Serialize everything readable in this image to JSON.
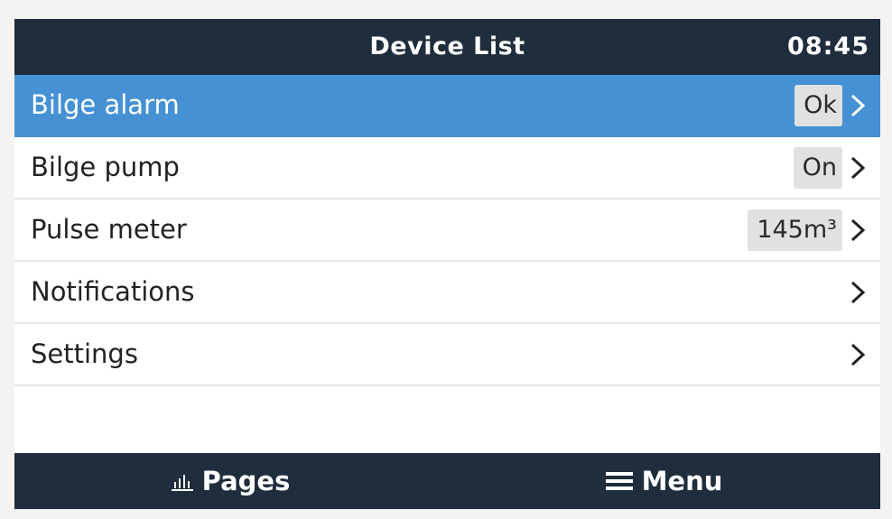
{
  "header": {
    "title": "Device List",
    "time": "08:45"
  },
  "items": [
    {
      "label": "Bilge alarm",
      "value": "Ok",
      "selected": true
    },
    {
      "label": "Bilge pump",
      "value": "On",
      "selected": false
    },
    {
      "label": "Pulse meter",
      "value": "145m³",
      "selected": false
    },
    {
      "label": "Notifications",
      "value": "",
      "selected": false
    },
    {
      "label": "Settings",
      "value": "",
      "selected": false
    }
  ],
  "footer": {
    "pages_label": "Pages",
    "pages_icon": "bar-chart-icon",
    "menu_label": "Menu",
    "menu_icon": "hamburger-icon"
  },
  "colors": {
    "header_bg": "#1f2d3c",
    "selected_bg": "#4691d4",
    "value_badge_bg": "#e1e1e1"
  }
}
